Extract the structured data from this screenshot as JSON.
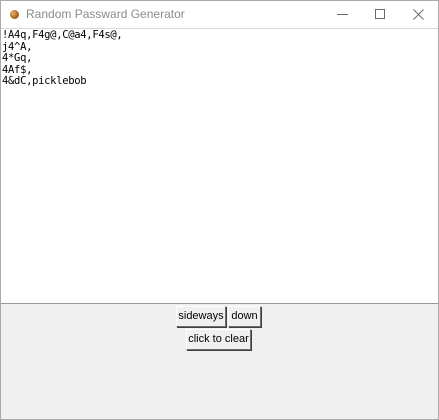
{
  "window": {
    "title": "Random Passward Generator",
    "controls": {
      "minimize_icon": "minimize-icon",
      "maximize_icon": "maximize-icon",
      "close_icon": "close-icon"
    }
  },
  "output": {
    "lines": [
      "!A4q,F4g@,C@a4,F4s@,",
      "j4^A,",
      "4*Gq,",
      "4Af$,",
      "4&dC,picklebob"
    ]
  },
  "buttons": {
    "sideways_label": "sideways",
    "down_label": "down",
    "clear_label": "click to clear"
  },
  "colors": {
    "window_background": "#f0f0f0",
    "text_area_background": "#ffffff",
    "title_text": "#8a8a8a"
  }
}
